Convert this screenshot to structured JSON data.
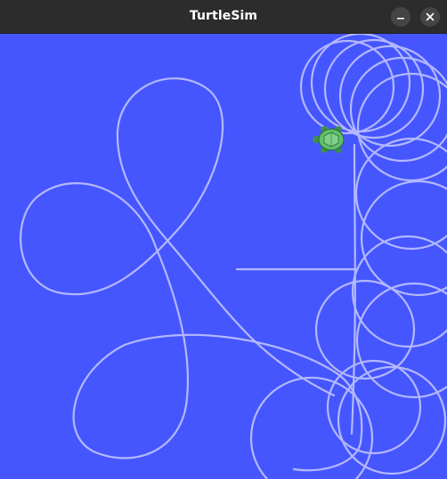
{
  "window": {
    "title": "TurtleSim"
  },
  "icons": {
    "minimize": "minimize-icon",
    "close": "close-icon",
    "turtle": "turtle-icon"
  },
  "colors": {
    "background": "#4556ff",
    "pen": "#b3b8ff",
    "titlebar": "#2c2c2c"
  }
}
